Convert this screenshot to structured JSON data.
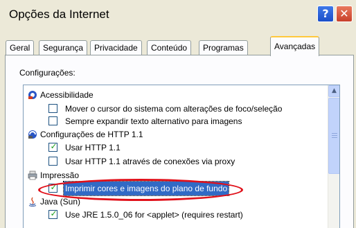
{
  "window": {
    "title": "Opções da Internet",
    "help_glyph": "?",
    "close_glyph": "✕"
  },
  "tabs": [
    {
      "label": "Geral"
    },
    {
      "label": "Segurança"
    },
    {
      "label": "Privacidade"
    },
    {
      "label": "Conteúdo"
    },
    {
      "label": "Programas"
    },
    {
      "label": "Avançadas",
      "active": true
    }
  ],
  "settings_label": "Configurações:",
  "settings": {
    "acessibilidade": {
      "label": "Acessibilidade",
      "icon": "accessibility-icon",
      "items": [
        {
          "label": "Mover o cursor do sistema com alterações de foco/seleção",
          "checked": false
        },
        {
          "label": "Sempre expandir texto alternativo para imagens",
          "checked": false
        }
      ]
    },
    "http": {
      "label": "Configurações de HTTP 1.1",
      "icon": "http-settings-icon",
      "items": [
        {
          "label": "Usar HTTP 1.1",
          "checked": true
        },
        {
          "label": "Usar HTTP 1.1 através de conexões via proxy",
          "checked": false
        }
      ]
    },
    "impressao": {
      "label": "Impressão",
      "icon": "printer-icon",
      "items": [
        {
          "label": "Imprimir cores e imagens do plano de fundo",
          "checked": true,
          "selected": true
        }
      ]
    },
    "java": {
      "label": "Java (Sun)",
      "icon": "java-icon",
      "items": [
        {
          "label": "Use JRE 1.5.0_06 for <applet> (requires restart)",
          "checked": true
        }
      ]
    }
  },
  "checkmark": "✓",
  "scroll_up_glyph": "▲",
  "colors": {
    "annotation_ellipse": "#e0101a",
    "selection": "#316ac5",
    "active_tab_accent": "#ffc83c"
  }
}
